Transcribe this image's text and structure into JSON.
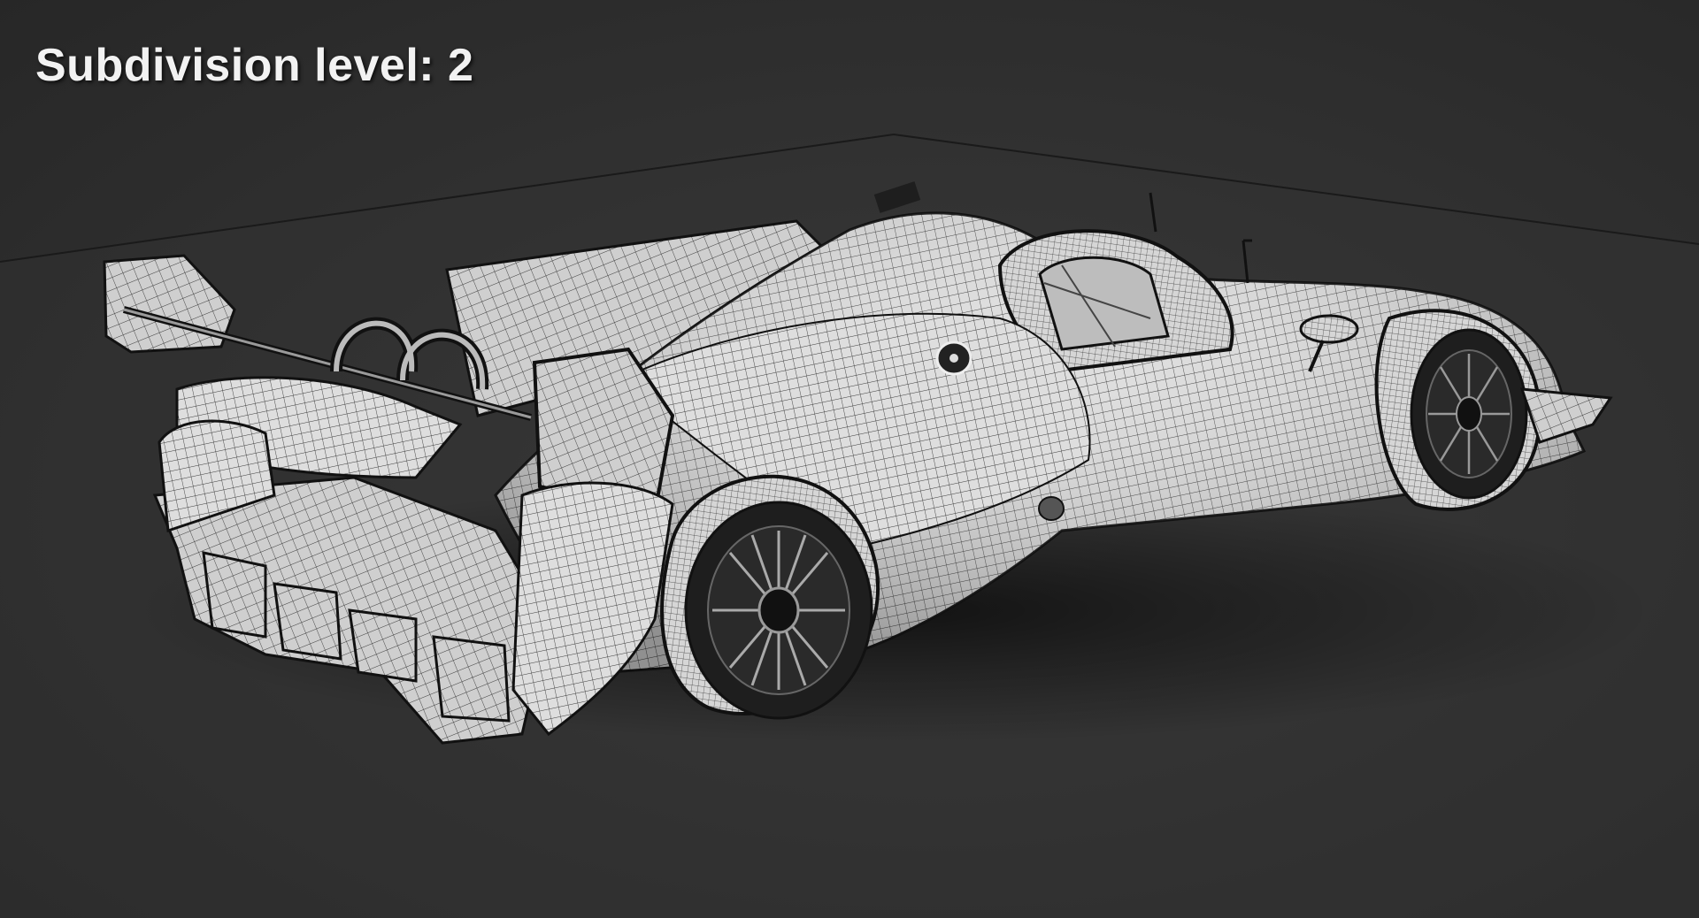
{
  "overlay": {
    "subdivision_label": "Subdivision level: 2"
  },
  "scene": {
    "subject": "wireframe-race-car",
    "background_color": "#303030",
    "mesh_fill_color": "#dcdcdc",
    "wire_color": "#2a2a2a"
  }
}
